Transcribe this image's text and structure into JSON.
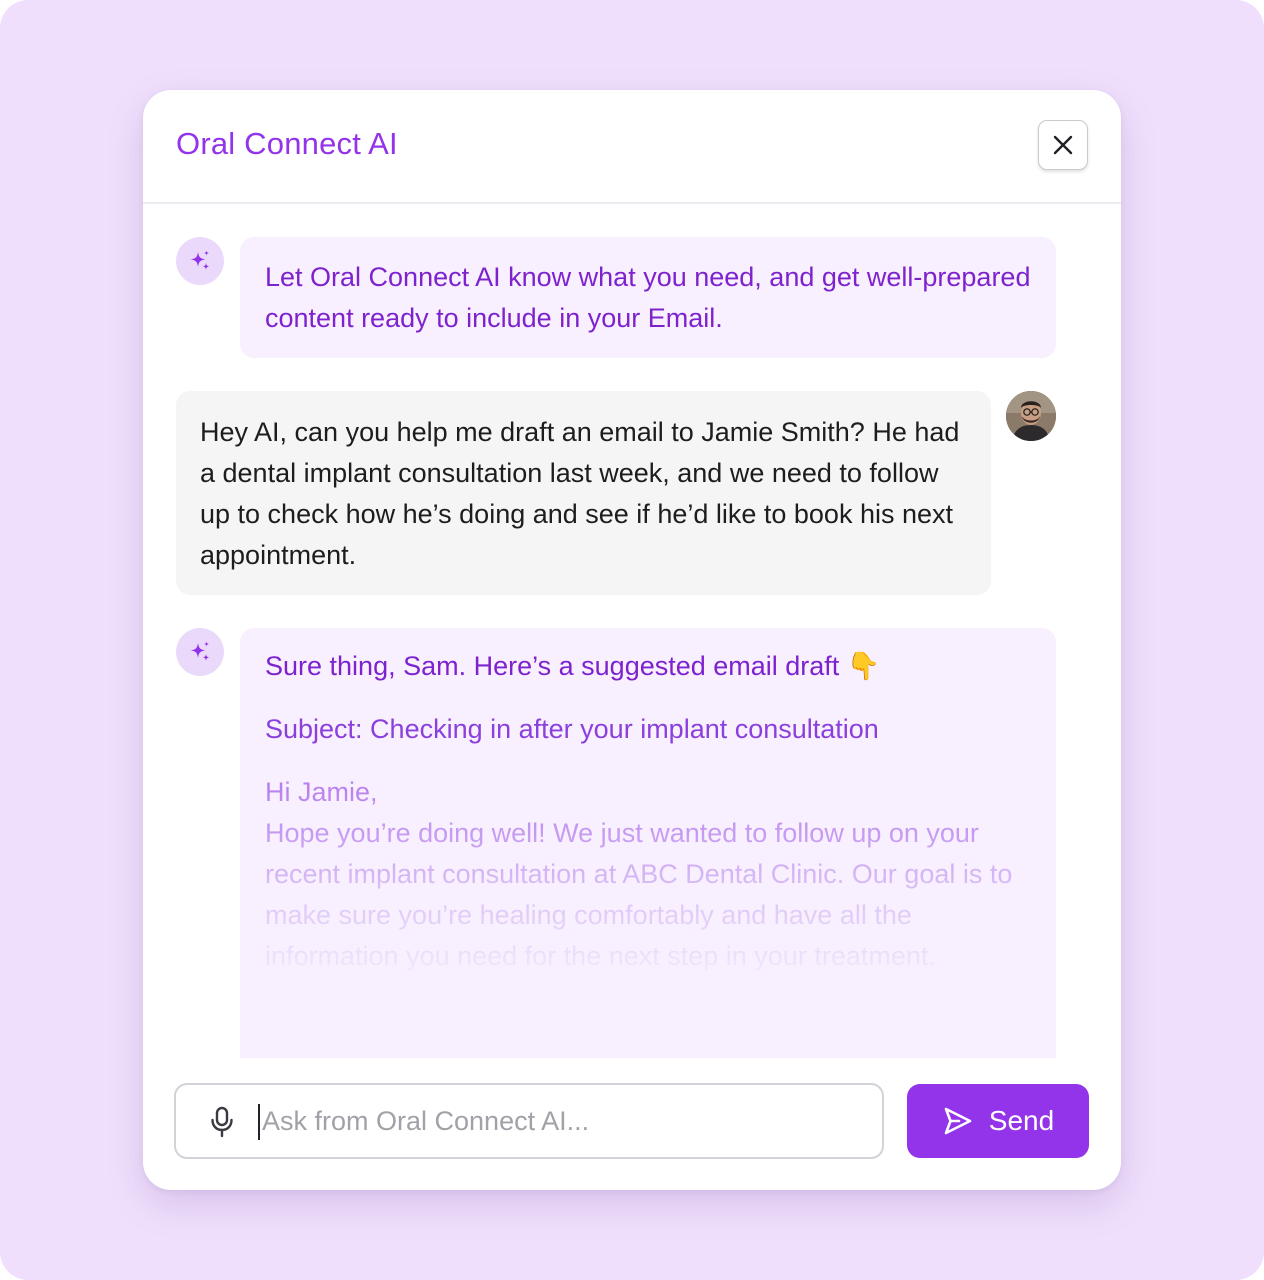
{
  "app": {
    "title": "Oral Connect AI",
    "accent_color": "#9333ea",
    "background_color": "#efdffc"
  },
  "header": {
    "close_icon": "close-icon"
  },
  "messages": [
    {
      "role": "assistant",
      "avatar_icon": "sparkles-icon",
      "text": "Let Oral Connect AI know what you need, and get well-prepared content ready to include in your Email."
    },
    {
      "role": "user",
      "avatar_icon": "user-avatar",
      "text": "Hey AI, can you help me draft an email to Jamie Smith? He had a dental implant consultation last week, and we need to follow up to check how he’s doing and see if he’d like to book his next appointment."
    },
    {
      "role": "assistant",
      "avatar_icon": "sparkles-icon",
      "intro": "Sure thing, Sam. Here’s a suggested email draft 👇",
      "subject": "Subject: Checking in after your implant consultation",
      "greeting": "Hi Jamie,",
      "body": "Hope you’re doing well! We just wanted to follow up on your recent implant consultation at ABC Dental Clinic. Our goal is to make sure you’re healing comfortably and have all the information you need for the next step in your treatment."
    }
  ],
  "composer": {
    "mic_icon": "microphone-icon",
    "placeholder": "Ask from Oral Connect AI...",
    "value": "",
    "send_label": "Send",
    "send_icon": "send-icon"
  }
}
